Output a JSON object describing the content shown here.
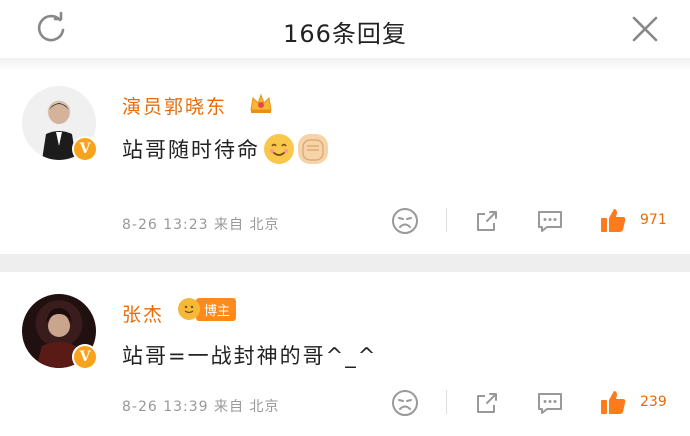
{
  "header": {
    "title": "166条回复",
    "refresh_icon": "refresh-icon",
    "close_icon": "close-icon"
  },
  "comments": [
    {
      "username": "演员郭晓东",
      "badge": "crown-icon",
      "text": "站哥随时待命",
      "emojis": [
        "smile-emoji",
        "fist-emoji"
      ],
      "meta": "8-26 13:23 来自 北京",
      "likes": "971"
    },
    {
      "username": "张杰",
      "badge_label": "博主",
      "text": "站哥=一战封神的哥^_^",
      "meta": "8-26 13:39 来自 北京",
      "likes": "239"
    }
  ],
  "colors": {
    "accent": "#e86b0a",
    "verified": "#f7a31b",
    "separator": "#eeeeee"
  }
}
